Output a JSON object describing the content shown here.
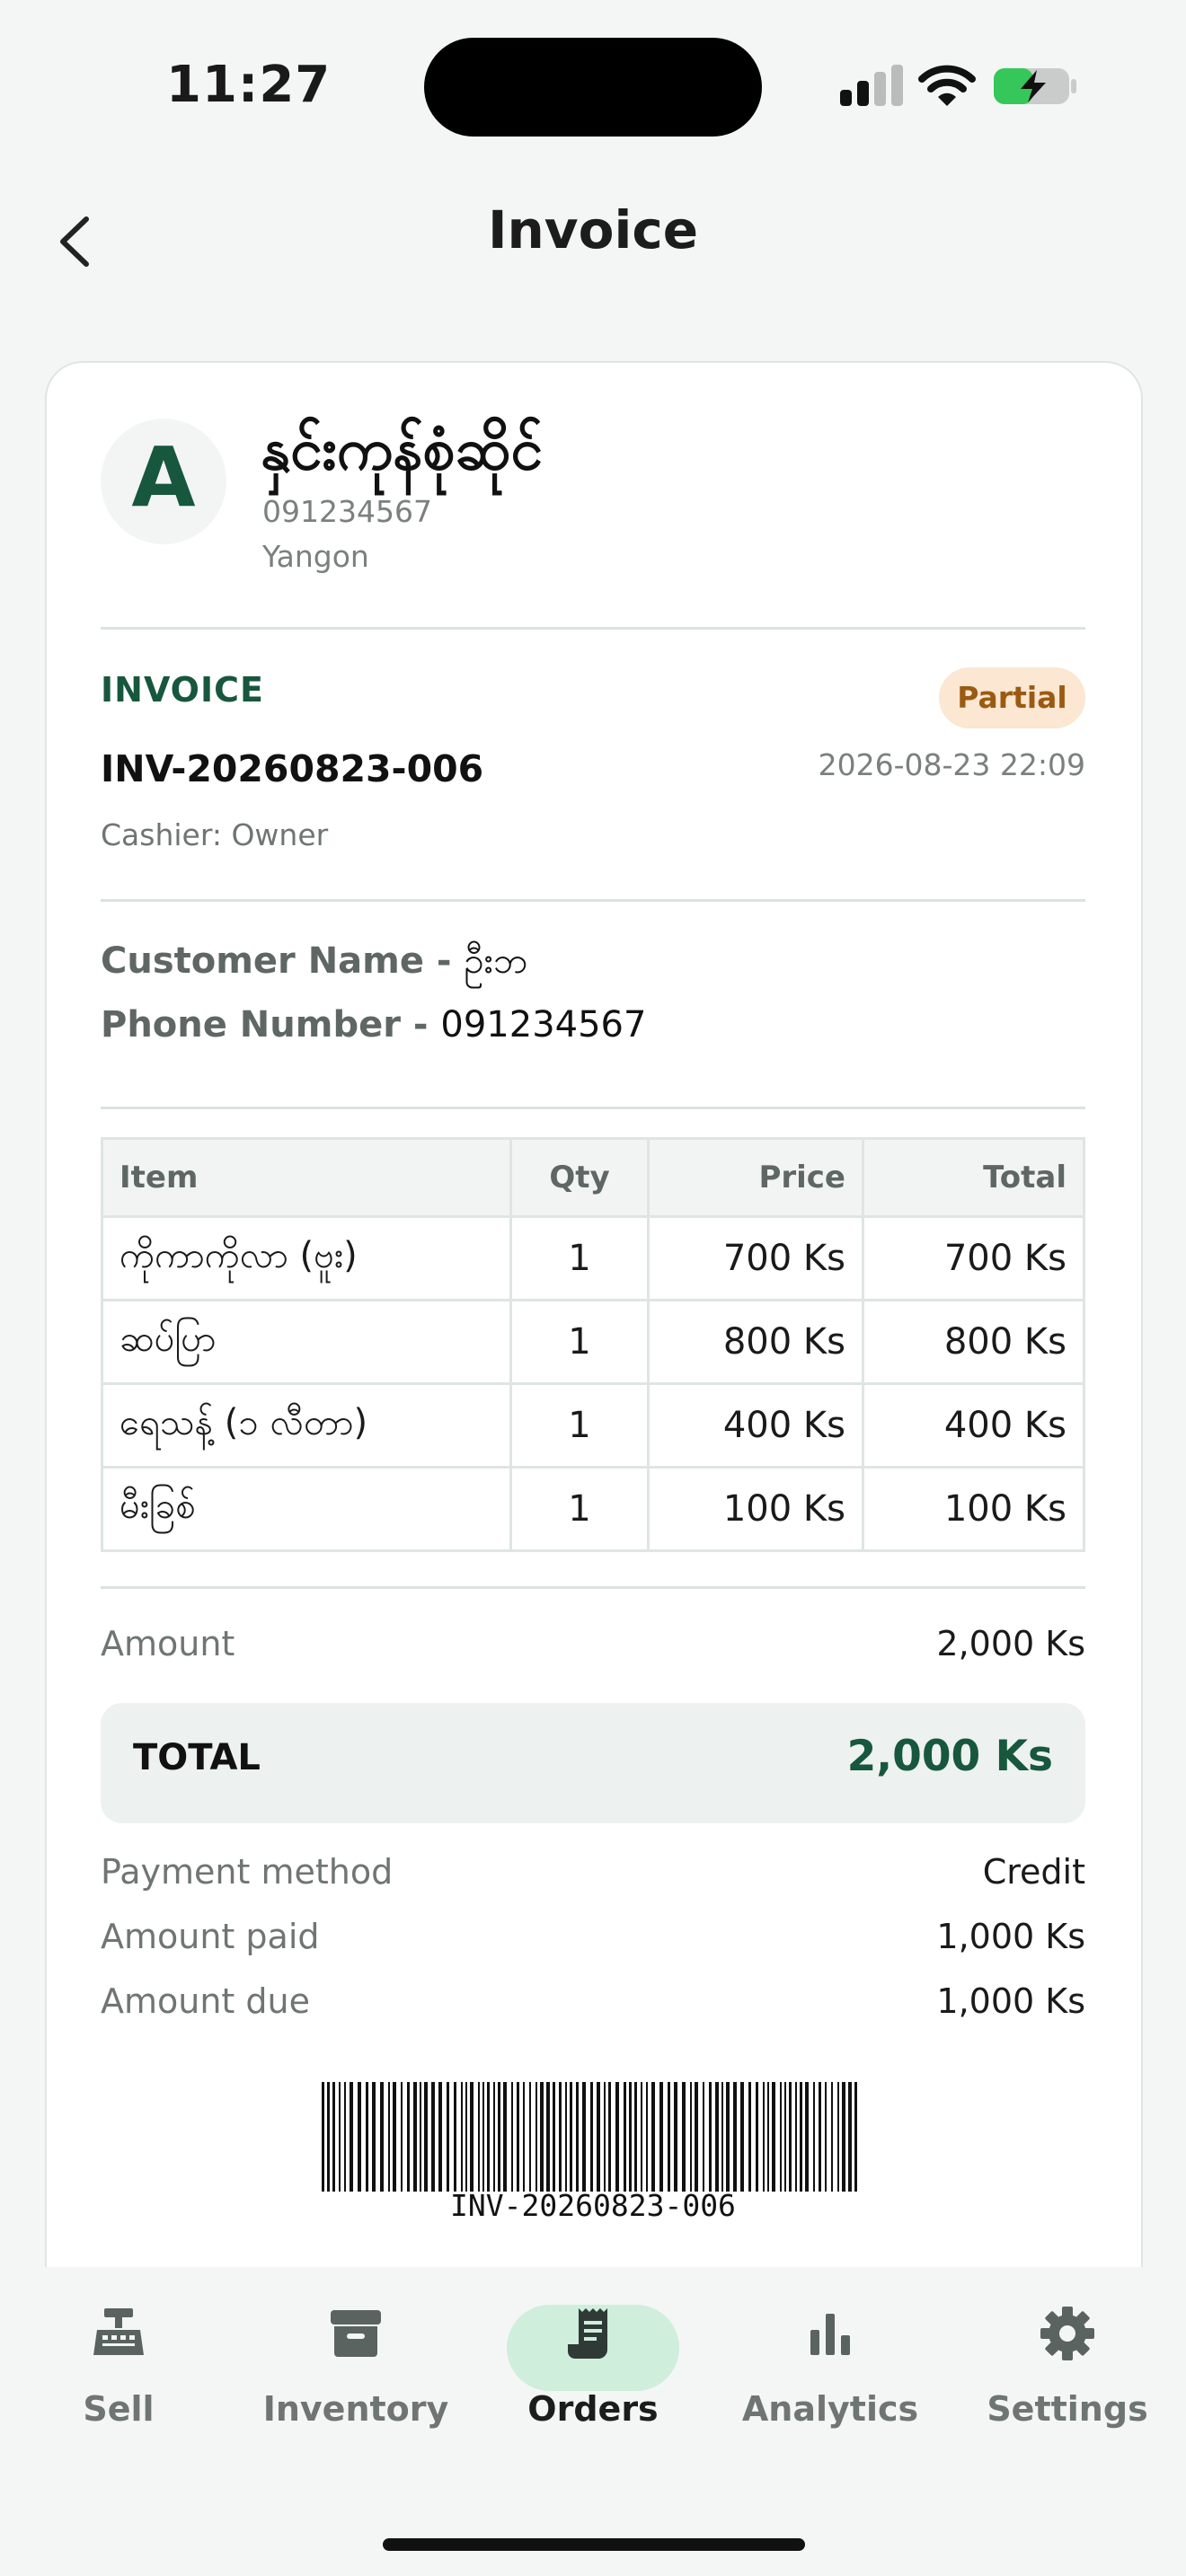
{
  "status": {
    "time": "11:27"
  },
  "header": {
    "title": "Invoice"
  },
  "shop": {
    "logo_letter": "A",
    "name": "နှင်းကုန်စုံဆိုင်",
    "phone": "091234567",
    "city": "Yangon"
  },
  "invoice": {
    "label": "INVOICE",
    "status": "Partial",
    "number": "INV-20260823-006",
    "date": "2026-08-23 22:09",
    "cashier": "Cashier: Owner"
  },
  "customer": {
    "name_label": "Customer Name - ",
    "name": "ဦးဘ",
    "phone_label": "Phone Number - ",
    "phone": "091234567"
  },
  "table": {
    "headers": {
      "item": "Item",
      "qty": "Qty",
      "price": "Price",
      "total": "Total"
    },
    "rows": [
      {
        "item": "ကိုကာကိုလာ (ဗူး)",
        "qty": "1",
        "price": "700 Ks",
        "total": "700 Ks"
      },
      {
        "item": "ဆပ်ပြာ",
        "qty": "1",
        "price": "800 Ks",
        "total": "800 Ks"
      },
      {
        "item": "ရေသန့် (၁ လီတာ)",
        "qty": "1",
        "price": "400 Ks",
        "total": "400 Ks"
      },
      {
        "item": "မီးခြစ်",
        "qty": "1",
        "price": "100 Ks",
        "total": "100 Ks"
      }
    ]
  },
  "summary": {
    "amount_label": "Amount",
    "amount": "2,000 Ks",
    "total_label": "TOTAL",
    "total": "2,000 Ks",
    "payment_method_label": "Payment method",
    "payment_method": "Credit",
    "amount_paid_label": "Amount paid",
    "amount_paid": "1,000 Ks",
    "amount_due_label": "Amount due",
    "amount_due": "1,000 Ks"
  },
  "barcode": {
    "text": "INV-20260823-006"
  },
  "tabs": [
    {
      "label": "Sell",
      "icon": "cash-register-icon"
    },
    {
      "label": "Inventory",
      "icon": "archive-box-icon"
    },
    {
      "label": "Orders",
      "icon": "receipt-icon",
      "active": true
    },
    {
      "label": "Analytics",
      "icon": "bar-chart-icon"
    },
    {
      "label": "Settings",
      "icon": "gear-icon"
    }
  ],
  "colors": {
    "brand_green": "#17573d",
    "partial_badge_bg": "#fbe7d2",
    "partial_badge_text": "#9b5a12",
    "active_tab_pill": "#cfeedb"
  }
}
